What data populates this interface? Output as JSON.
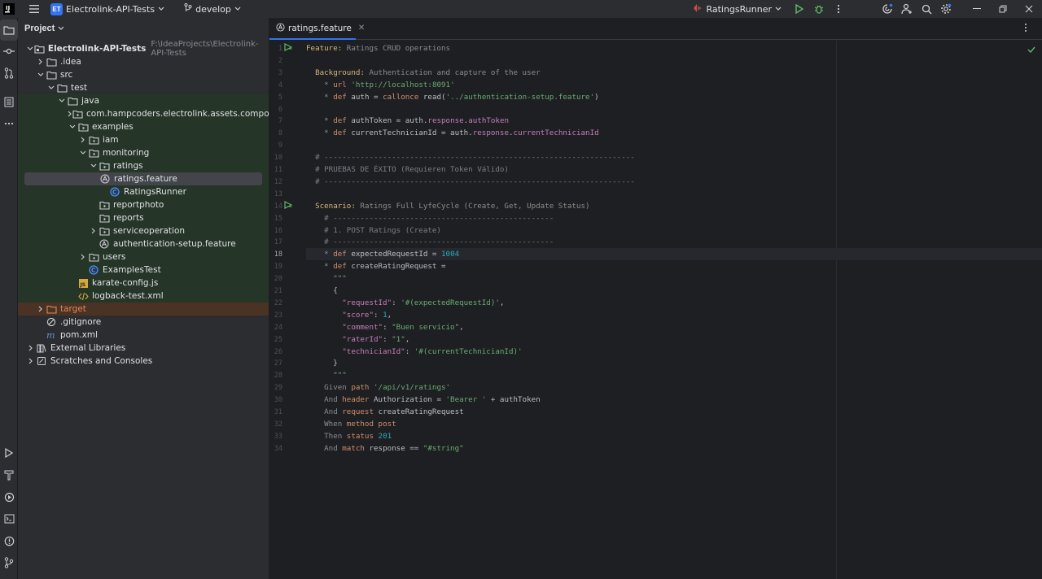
{
  "titlebar": {
    "project_badge": "ET",
    "project_name": "Electrolink-API-Tests",
    "branch": "develop",
    "run_config": "RatingsRunner"
  },
  "project_panel": {
    "title": "Project",
    "tree": [
      {
        "label": "Electrolink-API-Tests",
        "path": "F:\\IdeaProjects\\Electrolink-API-Tests"
      },
      {
        "label": ".idea"
      },
      {
        "label": "src"
      },
      {
        "label": "test"
      },
      {
        "label": "java"
      },
      {
        "label": "com.hampcoders.electrolink.assets.component"
      },
      {
        "label": "examples"
      },
      {
        "label": "iam"
      },
      {
        "label": "monitoring"
      },
      {
        "label": "ratings"
      },
      {
        "label": "ratings.feature"
      },
      {
        "label": "RatingsRunner"
      },
      {
        "label": "reportphoto"
      },
      {
        "label": "reports"
      },
      {
        "label": "serviceoperation"
      },
      {
        "label": "authentication-setup.feature"
      },
      {
        "label": "users"
      },
      {
        "label": "ExamplesTest"
      },
      {
        "label": "karate-config.js"
      },
      {
        "label": "logback-test.xml"
      },
      {
        "label": "target"
      },
      {
        "label": ".gitignore"
      },
      {
        "label": "pom.xml"
      },
      {
        "label": "External Libraries"
      },
      {
        "label": "Scratches and Consoles"
      }
    ]
  },
  "editor": {
    "tab_label": "ratings.feature",
    "current_line": 18,
    "lines": [
      [
        [
          "fkw",
          "Feature:"
        ],
        [
          "gray",
          " Ratings CRUD operations"
        ]
      ],
      [],
      [
        [
          "t",
          "  "
        ],
        [
          "fkw",
          "Background:"
        ],
        [
          "gray",
          " Authentication and capture of the user"
        ]
      ],
      [
        [
          "t",
          "    "
        ],
        [
          "gray",
          "* "
        ],
        [
          "kw",
          "url"
        ],
        [
          "t",
          " "
        ],
        [
          "str",
          "'http://localhost:8091'"
        ]
      ],
      [
        [
          "t",
          "    "
        ],
        [
          "gray",
          "* "
        ],
        [
          "kw",
          "def"
        ],
        [
          "t",
          " auth = "
        ],
        [
          "kw",
          "callonce"
        ],
        [
          "t",
          " read("
        ],
        [
          "str",
          "'../authentication-setup.feature'"
        ],
        [
          "t",
          ")"
        ]
      ],
      [],
      [
        [
          "t",
          "    "
        ],
        [
          "gray",
          "* "
        ],
        [
          "kw",
          "def"
        ],
        [
          "t",
          " authToken = auth."
        ],
        [
          "prop",
          "response"
        ],
        [
          "t",
          "."
        ],
        [
          "prop",
          "authToken"
        ]
      ],
      [
        [
          "t",
          "    "
        ],
        [
          "gray",
          "* "
        ],
        [
          "kw",
          "def"
        ],
        [
          "t",
          " currentTechnicianId = auth."
        ],
        [
          "prop",
          "response"
        ],
        [
          "t",
          "."
        ],
        [
          "prop",
          "currentTechnicianId"
        ]
      ],
      [],
      [
        [
          "cm",
          "  # ---------------------------------------------------------------------"
        ]
      ],
      [
        [
          "cm",
          "  # PRUEBAS DE ÉXITO (Requieren Token Válido)"
        ]
      ],
      [
        [
          "cm",
          "  # ---------------------------------------------------------------------"
        ]
      ],
      [],
      [
        [
          "t",
          "  "
        ],
        [
          "fkw",
          "Scenario:"
        ],
        [
          "gray",
          " Ratings Full LyfeCycle (Create, Get, Update Status)"
        ]
      ],
      [
        [
          "cm",
          "    # -------------------------------------------------"
        ]
      ],
      [
        [
          "cm",
          "    # 1. POST Ratings (Create)"
        ]
      ],
      [
        [
          "cm",
          "    # -------------------------------------------------"
        ]
      ],
      [
        [
          "t",
          "    "
        ],
        [
          "gray",
          "* "
        ],
        [
          "kw",
          "def"
        ],
        [
          "t",
          " expectedRequestId = "
        ],
        [
          "num",
          "1004"
        ]
      ],
      [
        [
          "t",
          "    "
        ],
        [
          "gray",
          "* "
        ],
        [
          "kw",
          "def"
        ],
        [
          "t",
          " createRatingRequest ="
        ]
      ],
      [
        [
          "tq",
          "      \"\"\""
        ]
      ],
      [
        [
          "t",
          "      {"
        ]
      ],
      [
        [
          "t",
          "        "
        ],
        [
          "key",
          "\"requestId\""
        ],
        [
          "t",
          ": "
        ],
        [
          "str",
          "'#(expectedRequestId)'"
        ],
        [
          "t",
          ","
        ]
      ],
      [
        [
          "t",
          "        "
        ],
        [
          "key",
          "\"score\""
        ],
        [
          "t",
          ": "
        ],
        [
          "num",
          "1"
        ],
        [
          "t",
          ","
        ]
      ],
      [
        [
          "t",
          "        "
        ],
        [
          "key",
          "\"comment\""
        ],
        [
          "t",
          ": "
        ],
        [
          "str",
          "\"Buen servicio\""
        ],
        [
          "t",
          ","
        ]
      ],
      [
        [
          "t",
          "        "
        ],
        [
          "key",
          "\"raterId\""
        ],
        [
          "t",
          ": "
        ],
        [
          "str",
          "\"1\""
        ],
        [
          "t",
          ","
        ]
      ],
      [
        [
          "t",
          "        "
        ],
        [
          "key",
          "\"technicianId\""
        ],
        [
          "t",
          ": "
        ],
        [
          "str",
          "'#(currentTechnicianId)'"
        ]
      ],
      [
        [
          "t",
          "      }"
        ]
      ],
      [
        [
          "tq",
          "      \"\"\""
        ]
      ],
      [
        [
          "gray",
          "    Given "
        ],
        [
          "kw",
          "path"
        ],
        [
          "t",
          " "
        ],
        [
          "str",
          "'/api/v1/ratings'"
        ]
      ],
      [
        [
          "gray",
          "    And "
        ],
        [
          "kw",
          "header"
        ],
        [
          "t",
          " Authorization = "
        ],
        [
          "str",
          "'Bearer '"
        ],
        [
          "t",
          " + authToken"
        ]
      ],
      [
        [
          "gray",
          "    And "
        ],
        [
          "kw",
          "request"
        ],
        [
          "t",
          " createRatingRequest"
        ]
      ],
      [
        [
          "gray",
          "    When "
        ],
        [
          "kw",
          "method"
        ],
        [
          "t",
          " "
        ],
        [
          "kw",
          "post"
        ]
      ],
      [
        [
          "gray",
          "    Then "
        ],
        [
          "kw",
          "status"
        ],
        [
          "t",
          " "
        ],
        [
          "num",
          "201"
        ]
      ],
      [
        [
          "gray",
          "    And "
        ],
        [
          "kw",
          "match"
        ],
        [
          "t",
          " response == "
        ],
        [
          "str",
          "\"#string\""
        ]
      ]
    ]
  },
  "colors": {
    "accent": "#3574f0",
    "run_green": "#5fb865",
    "keyword": "#cf8e6d",
    "string": "#6aab73"
  }
}
